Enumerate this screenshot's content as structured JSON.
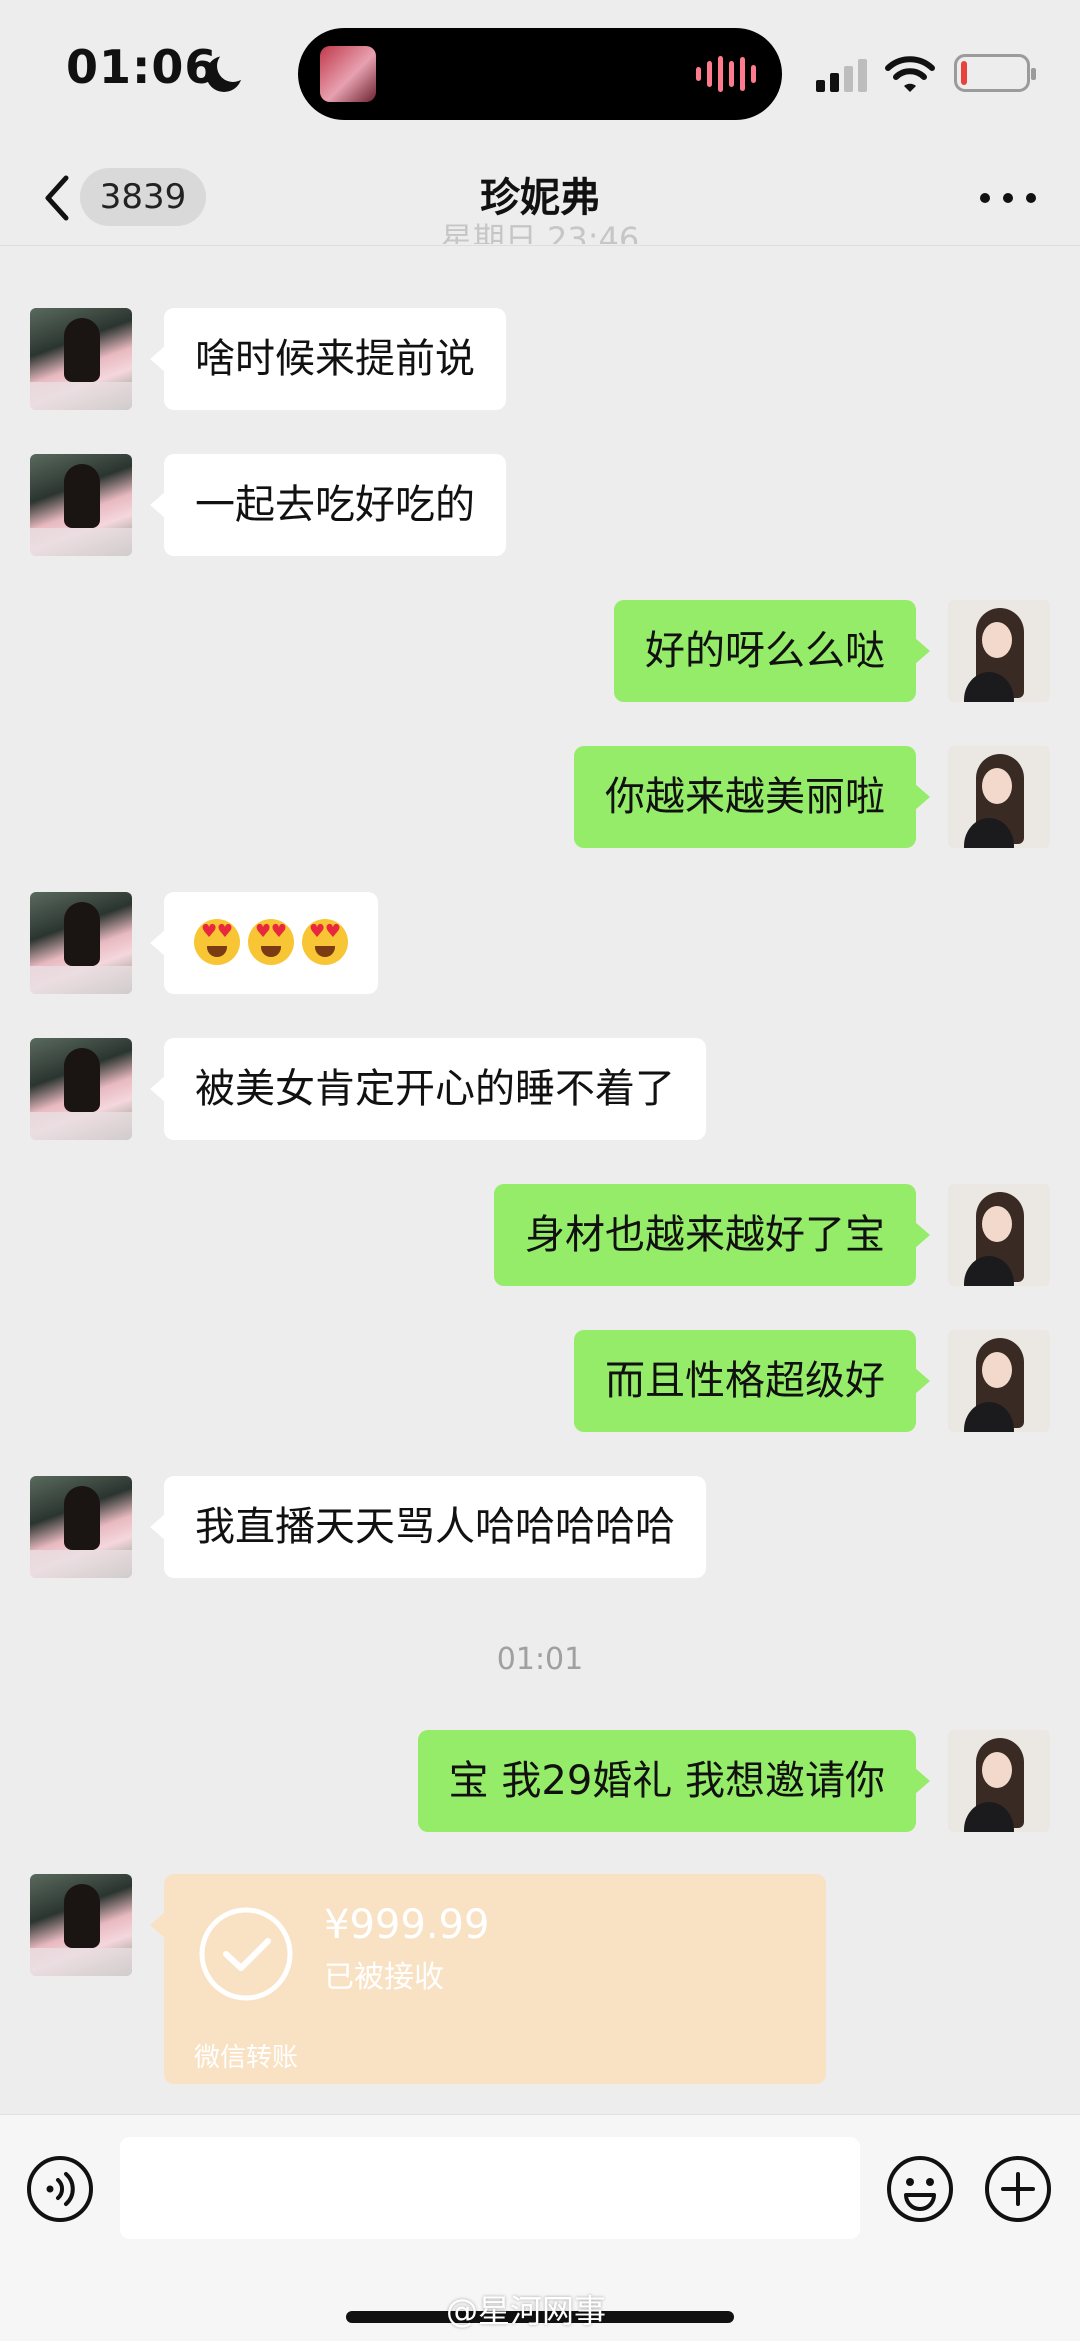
{
  "status_bar": {
    "time": "01:06",
    "icons": [
      "moon-icon",
      "dynamic-island",
      "signal-icon",
      "wifi-icon",
      "battery-icon"
    ],
    "battery_color": "#e8433b"
  },
  "nav": {
    "unread_count": "3839",
    "title": "珍妮弗",
    "faded_timestamp": "星期日 23:46",
    "icons": [
      "back-chevron-icon",
      "more-dots-icon"
    ]
  },
  "messages": [
    {
      "side": "left",
      "text": "啥时候来提前说"
    },
    {
      "side": "left",
      "text": "一起去吃好吃的"
    },
    {
      "side": "right",
      "text": "好的呀么么哒"
    },
    {
      "side": "right",
      "text": "你越来越美丽啦"
    },
    {
      "side": "left",
      "emoji": [
        "heart-eyes",
        "heart-eyes",
        "heart-eyes"
      ]
    },
    {
      "side": "left",
      "text": "被美女肯定开心的睡不着了"
    },
    {
      "side": "right",
      "text": "身材也越来越好了宝"
    },
    {
      "side": "right",
      "text": "而且性格超级好"
    },
    {
      "side": "left",
      "text": "我直播天天骂人哈哈哈哈哈"
    },
    {
      "side": "right",
      "text": "宝 我29婚礼 我想邀请你"
    }
  ],
  "time_divider": "01:01",
  "transfer": {
    "amount": "¥999.99",
    "status": "已被接收",
    "type_label": "微信转账",
    "icon": "check-circle-icon",
    "color": "#f9e2c4"
  },
  "input_bar": {
    "placeholder": "",
    "icons": [
      "voice-icon",
      "emoji-icon",
      "plus-icon"
    ]
  },
  "watermark": "@星河网事",
  "colors": {
    "background": "#ededed",
    "bubble_self": "#95ec69",
    "bubble_other": "#ffffff"
  }
}
